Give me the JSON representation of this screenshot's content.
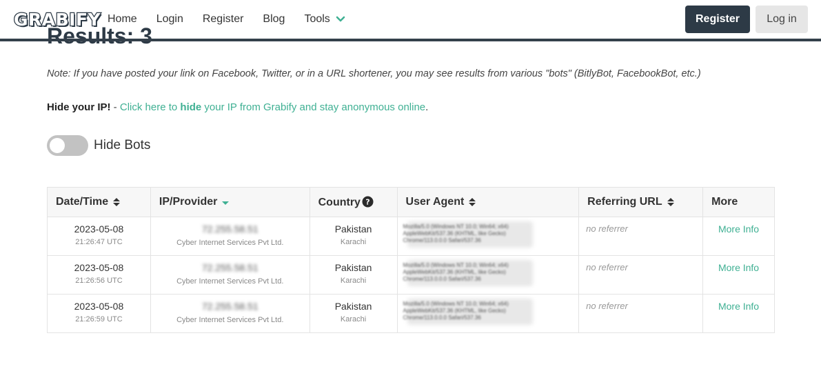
{
  "header": {
    "logo": "GRABIFY",
    "nav": [
      "Home",
      "Login",
      "Register",
      "Blog",
      "Tools"
    ],
    "register_button": "Register",
    "login_button": "Log in"
  },
  "main": {
    "heading": "Results: 3",
    "note": "Note: If you have posted your link on Facebook, Twitter, or in a URL shortener, you may see results from various \"bots\" (BitlyBot, FacebookBot, etc.)",
    "hide_ip": {
      "label": "Hide your IP!",
      "dash": " - ",
      "link_pre": "Click here to ",
      "link_bold": "hide",
      "link_post": " your IP from Grabify and stay anonymous online",
      "period": "."
    },
    "toggle": {
      "label": "Hide Bots",
      "on": false
    }
  },
  "table": {
    "headers": {
      "datetime": "Date/Time",
      "ip": "IP/Provider",
      "country": "Country",
      "user_agent": "User Agent",
      "referrer": "Referring URL",
      "more": "More"
    },
    "rows": [
      {
        "date": "2023-05-08",
        "time": "21:26:47 UTC",
        "ip": "72.255.58.51",
        "provider": "Cyber Internet Services Pvt Ltd.",
        "country": "Pakistan",
        "city": "Karachi",
        "ua1": "Mozilla/5.0 (Windows NT 10.0; Win64; x64)",
        "ua2": "AppleWebKit/537.36 (KHTML, like Gecko)",
        "ua3": "Chrome/113.0.0.0 Safari/537.36",
        "referrer": "no referrer",
        "more": "More Info"
      },
      {
        "date": "2023-05-08",
        "time": "21:26:56 UTC",
        "ip": "72.255.58.51",
        "provider": "Cyber Internet Services Pvt Ltd.",
        "country": "Pakistan",
        "city": "Karachi",
        "ua1": "Mozilla/5.0 (Windows NT 10.0; Win64; x64)",
        "ua2": "AppleWebKit/537.36 (KHTML, like Gecko)",
        "ua3": "Chrome/113.0.0.0 Safari/537.36",
        "referrer": "no referrer",
        "more": "More Info"
      },
      {
        "date": "2023-05-08",
        "time": "21:26:59 UTC",
        "ip": "72.255.58.51",
        "provider": "Cyber Internet Services Pvt Ltd.",
        "country": "Pakistan",
        "city": "Karachi",
        "ua1": "Mozilla/5.0 (Windows NT 10.0; Win64; x64)",
        "ua2": "AppleWebKit/537.36 (KHTML, like Gecko)",
        "ua3": "Chrome/113.0.0.0 Safari/537.36",
        "referrer": "no referrer",
        "more": "More Info"
      }
    ]
  },
  "colors": {
    "brand_dark": "#2d3a46",
    "accent_green": "#3fb093"
  },
  "icons": {
    "tools_chevron": "chevron-down-icon",
    "sort": "sort-icon",
    "sort_active": "sort-desc-icon",
    "country_help": "question-circle-icon"
  }
}
